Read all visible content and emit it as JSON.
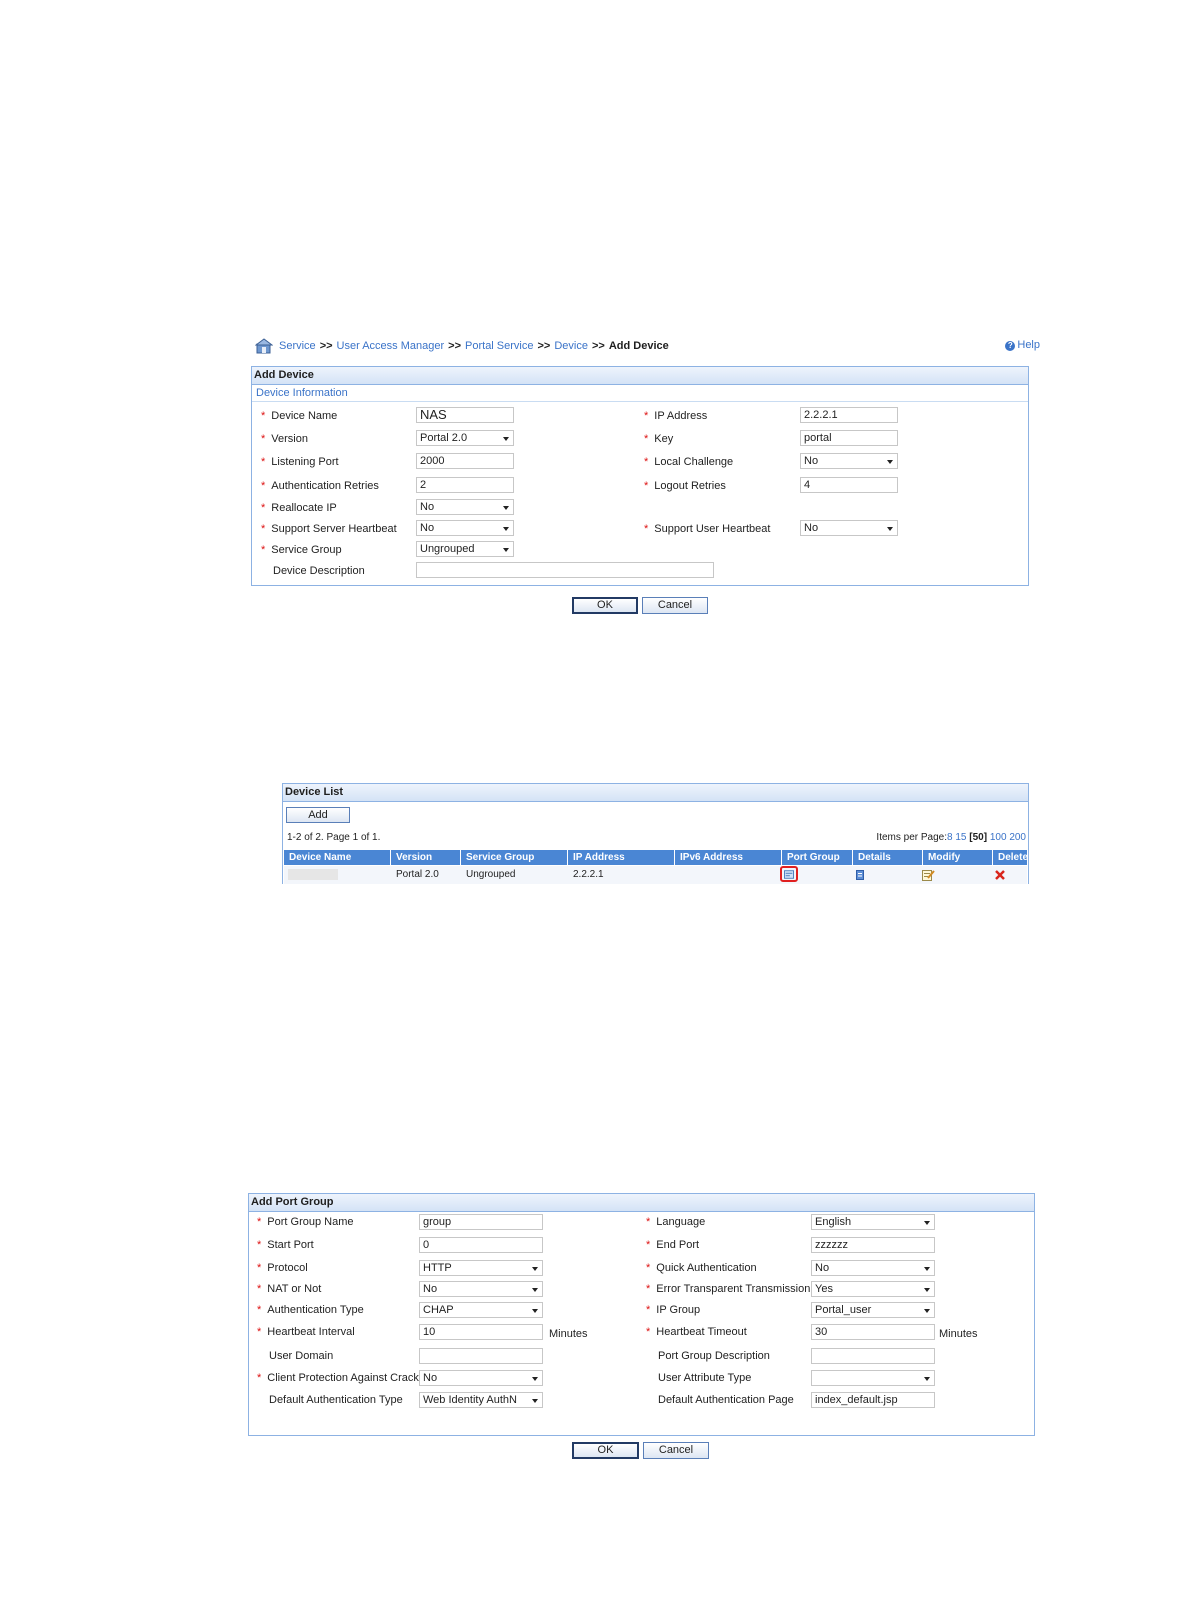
{
  "breadcrumb": {
    "items": [
      "Service",
      "User Access Manager",
      "Portal Service",
      "Device"
    ],
    "separator": ">>",
    "current": "Add Device",
    "help": "Help"
  },
  "add_device": {
    "title": "Add Device",
    "section": "Device Information",
    "fields": {
      "device_name": {
        "label": "Device Name",
        "value": "NAS"
      },
      "version": {
        "label": "Version",
        "value": "Portal 2.0"
      },
      "listening_port": {
        "label": "Listening Port",
        "value": "2000"
      },
      "auth_retries": {
        "label": "Authentication Retries",
        "value": "2"
      },
      "reallocate_ip": {
        "label": "Reallocate IP",
        "value": "No"
      },
      "server_heartbeat": {
        "label": "Support Server Heartbeat",
        "value": "No"
      },
      "service_group": {
        "label": "Service Group",
        "value": "Ungrouped"
      },
      "device_description": {
        "label": "Device Description",
        "value": ""
      },
      "ip_address": {
        "label": "IP Address",
        "value": "2.2.2.1"
      },
      "key": {
        "label": "Key",
        "value": "portal"
      },
      "local_challenge": {
        "label": "Local Challenge",
        "value": "No"
      },
      "logout_retries": {
        "label": "Logout Retries",
        "value": "4"
      },
      "user_heartbeat": {
        "label": "Support User Heartbeat",
        "value": "No"
      }
    },
    "ok": "OK",
    "cancel": "Cancel"
  },
  "device_list": {
    "title": "Device List",
    "add": "Add",
    "summary": "1-2 of 2. Page 1 of 1.",
    "items_per_page_label": "Items per Page:",
    "page_sizes": [
      "8",
      "15",
      "[50]",
      "100",
      "200"
    ],
    "columns": [
      "Device Name",
      "Version",
      "Service Group",
      "IP Address",
      "IPv6 Address",
      "Port Group",
      "Details",
      "Modify",
      "Delete"
    ],
    "rows": [
      {
        "device_name": "",
        "version": "Portal 2.0",
        "service_group": "Ungrouped",
        "ip_address": "2.2.2.1",
        "ipv6_address": ""
      }
    ],
    "colors": {
      "header": "#4a86d4",
      "highlight": "#e02020",
      "delete": "#d9261c"
    }
  },
  "add_port_group": {
    "title": "Add Port Group",
    "fields": {
      "port_group_name": {
        "label": "Port Group Name",
        "value": "group"
      },
      "start_port": {
        "label": "Start Port",
        "value": "0"
      },
      "protocol": {
        "label": "Protocol",
        "value": "HTTP"
      },
      "nat": {
        "label": "NAT or Not",
        "value": "No"
      },
      "auth_type": {
        "label": "Authentication Type",
        "value": "CHAP"
      },
      "heartbeat_interval": {
        "label": "Heartbeat Interval",
        "value": "10",
        "unit": "Minutes"
      },
      "user_domain": {
        "label": "User Domain",
        "value": ""
      },
      "client_protection": {
        "label": "Client Protection Against Cracks",
        "value": "No"
      },
      "default_auth_type": {
        "label": "Default Authentication Type",
        "value": "Web Identity AuthN"
      },
      "language": {
        "label": "Language",
        "value": "English"
      },
      "end_port": {
        "label": "End Port",
        "value": "zzzzzz"
      },
      "quick_auth": {
        "label": "Quick Authentication",
        "value": "No"
      },
      "error_transparent": {
        "label": "Error Transparent Transmission",
        "value": "Yes"
      },
      "ip_group": {
        "label": "IP Group",
        "value": "Portal_user"
      },
      "heartbeat_timeout": {
        "label": "Heartbeat Timeout",
        "value": "30",
        "unit": "Minutes"
      },
      "port_group_description": {
        "label": "Port Group Description",
        "value": ""
      },
      "user_attribute_type": {
        "label": "User Attribute Type",
        "value": ""
      },
      "default_auth_page": {
        "label": "Default Authentication Page",
        "value": "index_default.jsp"
      }
    },
    "ok": "OK",
    "cancel": "Cancel"
  }
}
